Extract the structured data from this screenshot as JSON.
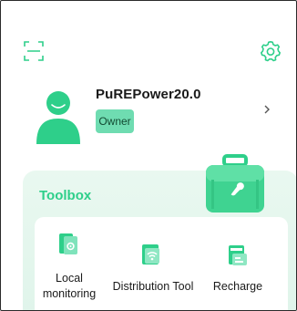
{
  "header": {
    "scan_icon": "scan-icon",
    "settings_icon": "gear-icon"
  },
  "profile": {
    "name": "PuREPower20.0",
    "role": "Owner",
    "avatar_icon": "user-avatar-icon",
    "chevron_icon": "chevron-right-icon"
  },
  "toolbox": {
    "title": "Toolbox",
    "image_icon": "toolbox-icon",
    "tools": [
      {
        "label_line1": "Local",
        "label_line2": "monitoring",
        "icon": "local-monitoring-icon"
      },
      {
        "label": "Distribution Tool",
        "icon": "distribution-tool-icon"
      },
      {
        "label": "Recharge",
        "icon": "recharge-icon"
      }
    ]
  },
  "colors": {
    "accent": "#2ecf8a",
    "badge": "#6fdcb1",
    "card_bg": "#e6f7ee"
  }
}
